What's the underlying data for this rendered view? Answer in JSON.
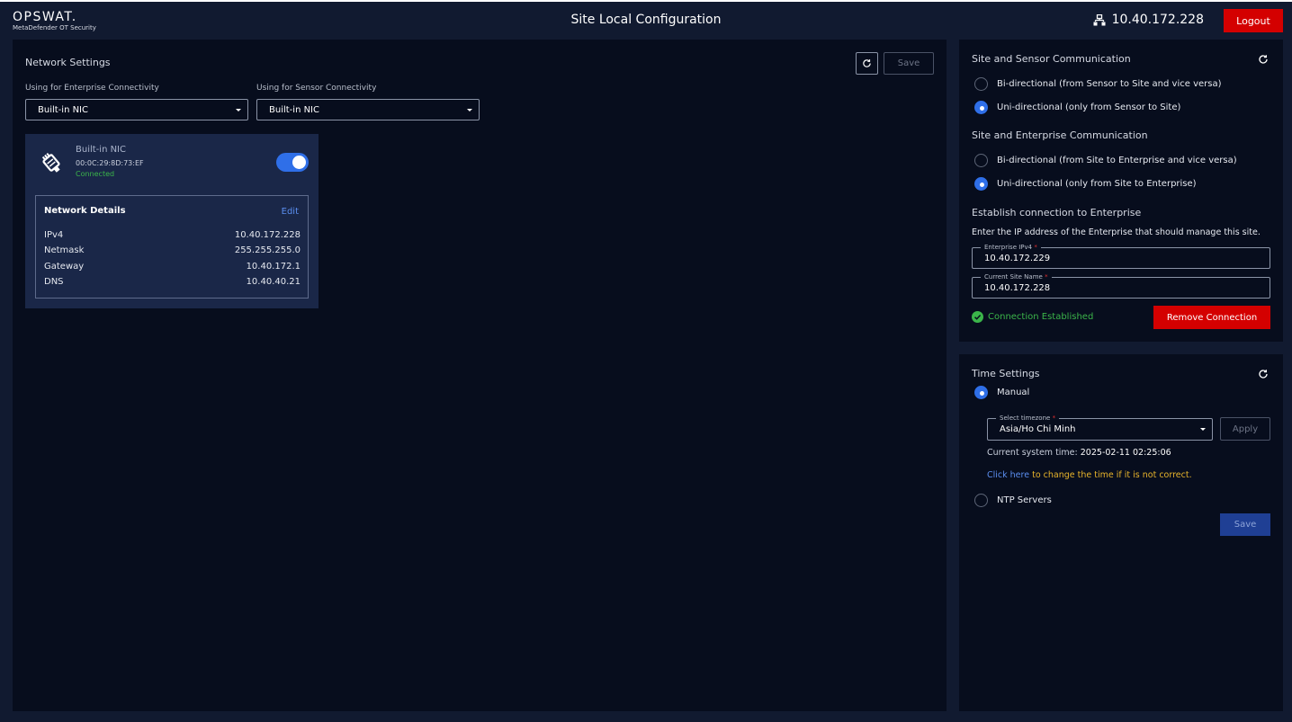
{
  "header": {
    "logo_main": "OPSWAT.",
    "logo_sub": "MetaDefender OT Security",
    "title": "Site Local Configuration",
    "host_ip": "10.40.172.228",
    "logout_label": "Logout"
  },
  "network": {
    "title": "Network Settings",
    "save_label": "Save",
    "enterprise_label": "Using for Enterprise Connectivity",
    "enterprise_value": "Built-in NIC",
    "sensor_label": "Using for Sensor Connectivity",
    "sensor_value": "Built-in NIC",
    "nic": {
      "name": "Built-in NIC",
      "mac": "00:0C:29:8D:73:EF",
      "status": "Connected",
      "enabled": true,
      "details_title": "Network Details",
      "edit_label": "Edit",
      "rows": [
        {
          "label": "IPv4",
          "value": "10.40.172.228"
        },
        {
          "label": "Netmask",
          "value": "255.255.255.0"
        },
        {
          "label": "Gateway",
          "value": "10.40.172.1"
        },
        {
          "label": "DNS",
          "value": "10.40.40.21"
        }
      ]
    }
  },
  "comm": {
    "sensor_title": "Site and Sensor Communication",
    "sensor_options": [
      "Bi-directional (from Sensor to Site and vice versa)",
      "Uni-directional (only from Sensor to Site)"
    ],
    "sensor_selected": 1,
    "enterprise_title": "Site and Enterprise Communication",
    "enterprise_options": [
      "Bi-directional (from Site to Enterprise and vice versa)",
      "Uni-directional (only from Site to Enterprise)"
    ],
    "enterprise_selected": 1,
    "establish_title": "Establish connection to Enterprise",
    "establish_desc": "Enter the IP address of the Enterprise that should manage this site.",
    "enterprise_ip_label": "Enterprise IPv4",
    "enterprise_ip_value": "10.40.172.229",
    "site_name_label": "Current Site Name",
    "site_name_value": "10.40.172.228",
    "required_mark": "*",
    "status_text": "Connection Established",
    "remove_label": "Remove Connection"
  },
  "time": {
    "title": "Time Settings",
    "manual_label": "Manual",
    "timezone_label": "Select timezone",
    "timezone_value": "Asia/Ho Chi Minh",
    "apply_label": "Apply",
    "system_time_label": "Current system time:",
    "system_time_value": "2025-02-11 02:25:06",
    "click_here": "Click here",
    "change_text": "to change the time if it is not correct.",
    "ntp_label": "NTP Servers",
    "save_label": "Save"
  },
  "colors": {
    "accent": "#2f6fe8",
    "danger": "#d40000",
    "success": "#3bb54a",
    "warning": "#e8b42b"
  }
}
